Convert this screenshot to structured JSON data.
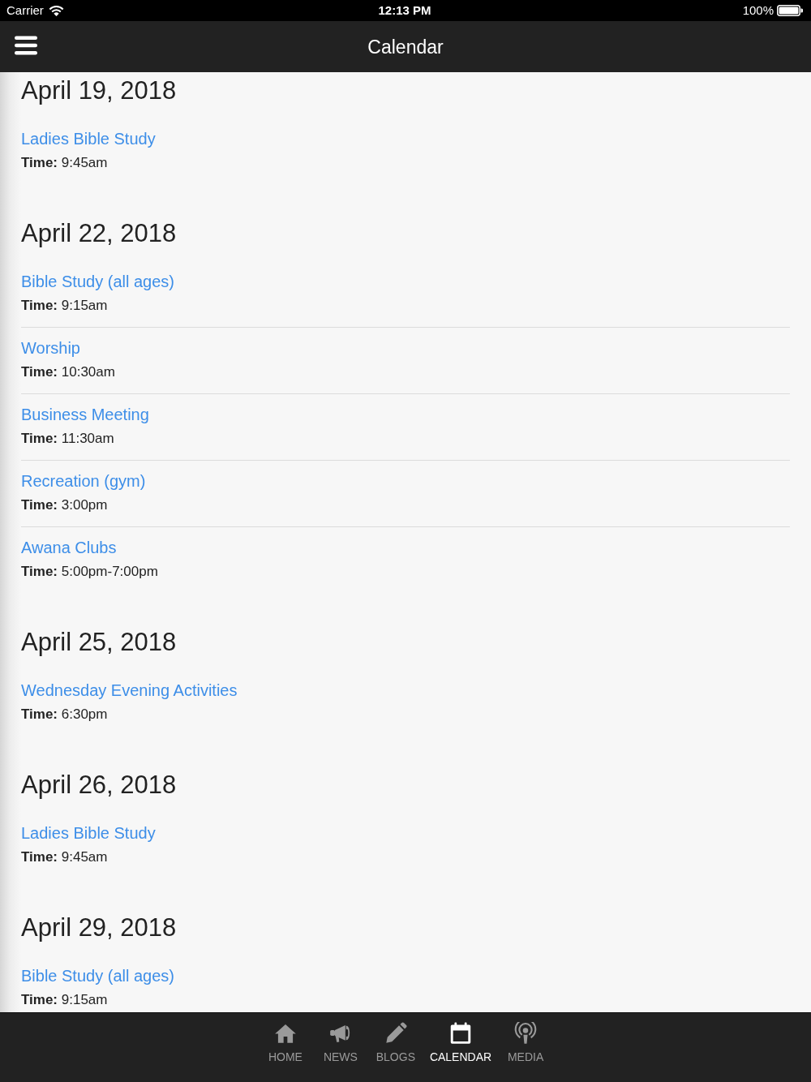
{
  "status_bar": {
    "carrier": "Carrier",
    "time": "12:13 PM",
    "battery": "100%"
  },
  "nav_bar": {
    "title": "Calendar"
  },
  "days": [
    {
      "date": "April 19, 2018",
      "events": [
        {
          "title": "Ladies Bible Study",
          "time": "**Time:** 9:45am"
        }
      ]
    },
    {
      "date": "April 22, 2018",
      "events": [
        {
          "title": "Bible Study (all ages)",
          "time": "**Time:** 9:15am"
        },
        {
          "title": "Worship",
          "time": "**Time:** 10:30am"
        },
        {
          "title": "Business Meeting",
          "time": "**Time:** 11:30am"
        },
        {
          "title": "Recreation (gym)",
          "time": "**Time:** 3:00pm"
        },
        {
          "title": "Awana Clubs",
          "time": "**Time:** 5:00pm-7:00pm"
        }
      ]
    },
    {
      "date": "April 25, 2018",
      "events": [
        {
          "title": "Wednesday Evening Activities",
          "time": "**Time:** 6:30pm"
        }
      ]
    },
    {
      "date": "April 26, 2018",
      "events": [
        {
          "title": "Ladies Bible Study",
          "time": "**Time:** 9:45am"
        }
      ]
    },
    {
      "date": "April 29, 2018",
      "events": [
        {
          "title": "Bible Study (all ages)",
          "time": "**Time:** 9:15am"
        }
      ]
    }
  ],
  "tab_bar": [
    {
      "label": "HOME",
      "selected": false
    },
    {
      "label": "NEWS",
      "selected": false
    },
    {
      "label": "BLOGS",
      "selected": false
    },
    {
      "label": "CALENDAR",
      "selected": true
    },
    {
      "label": "MEDIA",
      "selected": false
    }
  ]
}
